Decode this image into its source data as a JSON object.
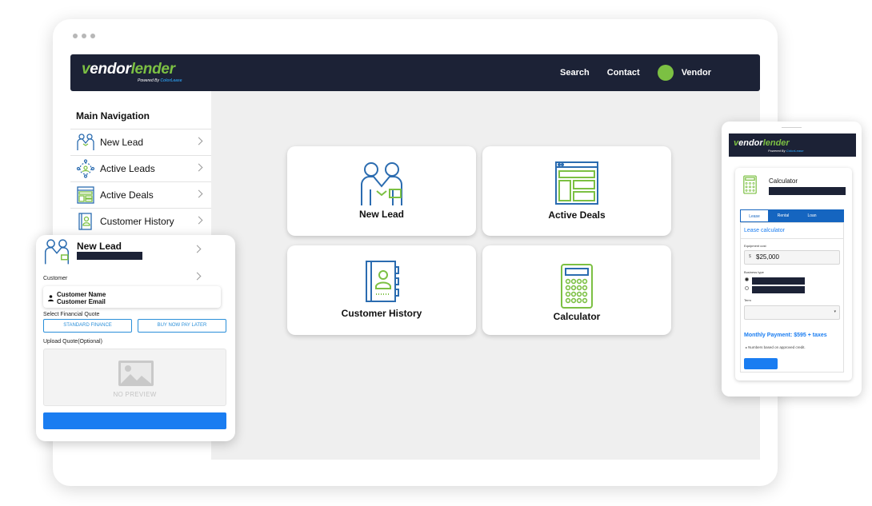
{
  "brand": {
    "logo_prefix": "v",
    "logo_vendor": "endor",
    "logo_lender": "lender",
    "powered_by": "Powered By",
    "powered_brand": "ColorLease",
    "accent_green": "#7cc043",
    "navy": "#1c2236",
    "blue": "#1a7df1"
  },
  "header": {
    "search": "Search",
    "contact": "Contact",
    "user": "Vendor"
  },
  "sidebar": {
    "title": "Main Navigation",
    "items": [
      {
        "label": "New Lead",
        "icon": "handshake-people-icon"
      },
      {
        "label": "Active Leads",
        "icon": "network-people-icon"
      },
      {
        "label": "Active Deals",
        "icon": "dashboard-layout-icon"
      },
      {
        "label": "Customer History",
        "icon": "contact-book-icon"
      }
    ]
  },
  "tiles": [
    {
      "label": "New Lead",
      "icon": "handshake-people-icon"
    },
    {
      "label": "Active Deals",
      "icon": "dashboard-layout-icon"
    },
    {
      "label": "Customer History",
      "icon": "contact-book-icon"
    },
    {
      "label": "Calculator",
      "icon": "calculator-icon"
    }
  ],
  "lead_form": {
    "title": "New Lead",
    "customer_label": "Customer",
    "customer_name": "Customer Name",
    "customer_email": "Customer Email",
    "quote_label": "Select Financial Quote",
    "standard": "STANDARD FINANCE",
    "bnpl": "BUY NOW PAY LATER",
    "upload_label": "Upload Quote(Optional)",
    "no_preview": "NO PREVIEW"
  },
  "calculator": {
    "title": "Calculator",
    "tabs": [
      "Lease",
      "Rental",
      "Loan"
    ],
    "active_tab": "Lease",
    "heading": "Lease calculator",
    "equipment_label": "Equipment cost",
    "currency": "$",
    "equipment_value": "$25,000",
    "business_label": "Business type",
    "term_label": "Term",
    "monthly": "Monthly Payment: $595 + taxes",
    "note": "Numbers based on approved credit."
  }
}
